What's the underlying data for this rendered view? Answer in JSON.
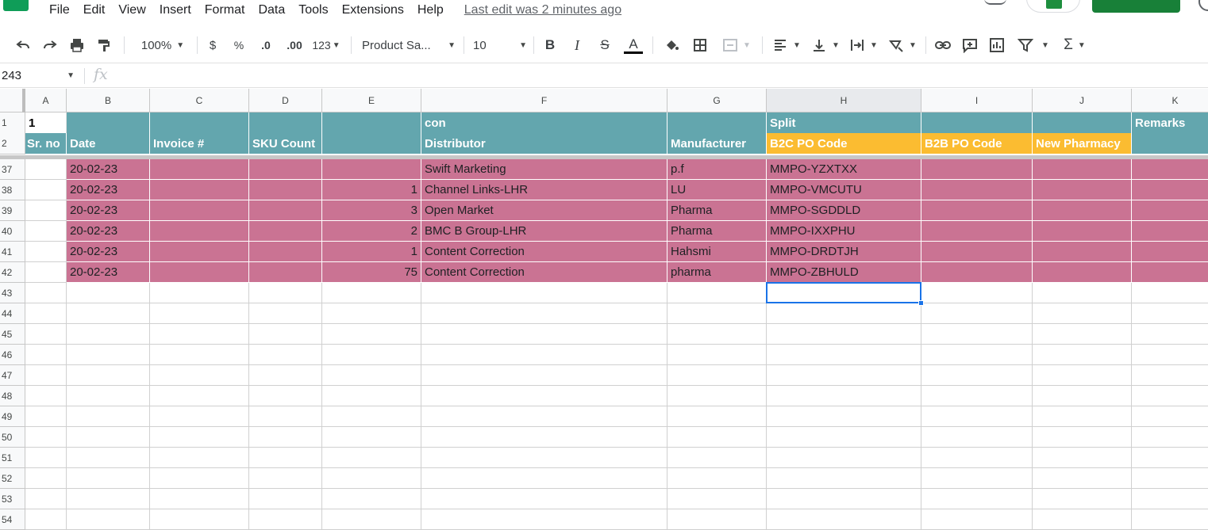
{
  "menu": {
    "items": [
      "File",
      "Edit",
      "View",
      "Insert",
      "Format",
      "Data",
      "Tools",
      "Extensions",
      "Help"
    ],
    "last_edit": "Last edit was 2 minutes ago"
  },
  "toolbar": {
    "zoom": "100%",
    "currency": "$",
    "percent": "%",
    "decrease_decimal": ".0",
    "increase_decimal": ".00",
    "more_formats": "123",
    "font": "Product Sa...",
    "font_size": "10",
    "bold": "B",
    "italic": "I",
    "strikethrough": "S",
    "text_color": "A",
    "text_color_swatch": "#000000",
    "sum": "Σ"
  },
  "formula_bar": {
    "name_box": "243",
    "fx": "fx",
    "content": ""
  },
  "columns": [
    "A",
    "B",
    "C",
    "D",
    "E",
    "F",
    "G",
    "H",
    "I",
    "J",
    "K"
  ],
  "header_rows": [
    {
      "row_label": "1",
      "cells": [
        "1",
        "",
        "",
        "",
        "",
        "con",
        "",
        "Split",
        "",
        "",
        "Remarks"
      ]
    },
    {
      "row_label": "2",
      "cells": [
        "Sr. no",
        "Date",
        "Invoice #",
        "SKU Count",
        "",
        "Distributor",
        "Manufacturer",
        "B2C PO Code",
        "B2B PO Code",
        "New Pharmacy",
        ""
      ]
    }
  ],
  "data_rows": [
    {
      "row_label": "37",
      "cells": [
        "",
        "20-02-23",
        "",
        "",
        "",
        "Swift Marketing",
        "p.f",
        "MMPO-YZXTXX",
        "",
        "",
        ""
      ]
    },
    {
      "row_label": "38",
      "cells": [
        "",
        "20-02-23",
        "",
        "",
        "1",
        "Channel Links-LHR",
        "LU",
        "MMPO-VMCUTU",
        "",
        "",
        ""
      ]
    },
    {
      "row_label": "39",
      "cells": [
        "",
        "20-02-23",
        "",
        "",
        "3",
        "Open Market",
        "Pharma",
        "MMPO-SGDDLD",
        "",
        "",
        ""
      ]
    },
    {
      "row_label": "40",
      "cells": [
        "",
        "20-02-23",
        "",
        "",
        "2",
        "BMC B Group-LHR",
        "Pharma",
        "MMPO-IXXPHU",
        "",
        "",
        ""
      ]
    },
    {
      "row_label": "41",
      "cells": [
        "",
        "20-02-23",
        "",
        "",
        "1",
        "Content Correction",
        "Hahsmi",
        "MMPO-DRDTJH",
        "",
        "",
        ""
      ]
    },
    {
      "row_label": "42",
      "cells": [
        "",
        "20-02-23",
        "",
        "",
        "75",
        "Content Correction",
        "pharma",
        "MMPO-ZBHULD",
        "",
        "",
        ""
      ]
    }
  ],
  "empty_row_labels": [
    "43",
    "44",
    "45",
    "46",
    "47",
    "48",
    "49",
    "50",
    "51",
    "52",
    "53",
    "54"
  ],
  "colors": {
    "header_teal": "#63a6ae",
    "header_amber": "#fbbc31",
    "row_pink": "#ca7393",
    "selection_blue": "#1a73e8",
    "brand_green": "#188038"
  },
  "selected_cell": "H43"
}
